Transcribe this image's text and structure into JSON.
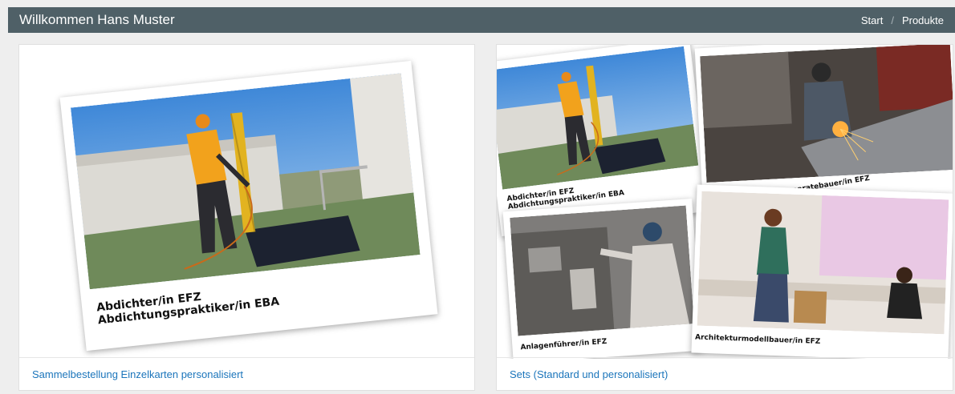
{
  "header": {
    "title": "Willkommen Hans Muster",
    "breadcrumb": {
      "home": "Start",
      "separator": "/",
      "current": "Produkte"
    }
  },
  "cards": {
    "left": {
      "link": "Sammelbestellung Einzelkarten personalisiert",
      "caption_line1": "Abdichter/in EFZ",
      "caption_line2": "Abdichtungspraktiker/in EBA"
    },
    "right": {
      "link": "Sets (Standard und personalisiert)",
      "photo1_line1": "Abdichter/in EFZ",
      "photo1_line2": "Abdichtungspraktiker/in EBA",
      "photo2": "Anlagen- und Apparatebauer/in EFZ",
      "photo3": "Anlagenführer/in EFZ",
      "photo4": "Architekturmodellbauer/in EFZ"
    }
  },
  "colors": {
    "header_bg": "#4f6067",
    "link": "#1b75bb",
    "page_bg": "#eeeeee"
  }
}
